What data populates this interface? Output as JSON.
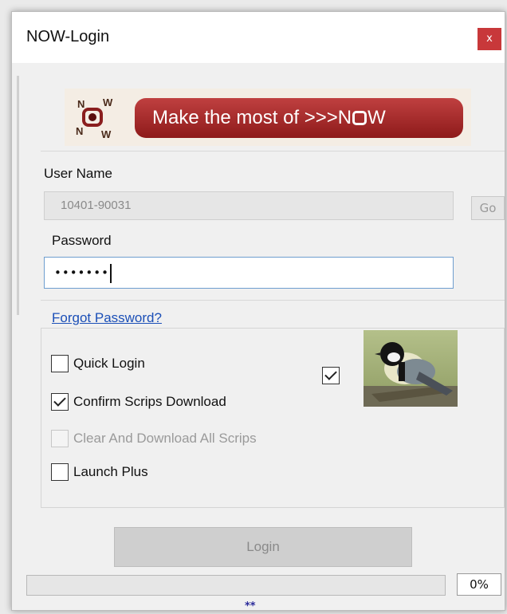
{
  "window": {
    "title": "NOW-Login",
    "close_label": "x"
  },
  "banner": {
    "logo_letters": [
      "N",
      "W",
      "N",
      "W"
    ],
    "text": "Make the most of >>>N",
    "brand_end": "W"
  },
  "username": {
    "label": "User Name",
    "value": "10401-90031",
    "go_label": "Go"
  },
  "password": {
    "label": "Password",
    "masked_value": "•••••••"
  },
  "forgot_link": "Forgot Password?",
  "options": [
    {
      "label": "Quick Login",
      "checked": false,
      "disabled": false
    },
    {
      "label": "Confirm Scrips Download",
      "checked": true,
      "disabled": false
    },
    {
      "label": "Clear And Download All Scrips",
      "checked": false,
      "disabled": true
    },
    {
      "label": "Launch Plus",
      "checked": false,
      "disabled": false
    }
  ],
  "extra_checkbox": {
    "checked": true
  },
  "login_button": "Login",
  "progress": {
    "fraction": 0,
    "label": "0%"
  },
  "footer_marker": "**",
  "colors": {
    "accent": "#c8383a",
    "banner": "#8e1a1a",
    "link": "#1b4fb7"
  },
  "icons": {
    "close": "close-icon",
    "logo": "now-logo-icon",
    "bird": "bird-image"
  }
}
